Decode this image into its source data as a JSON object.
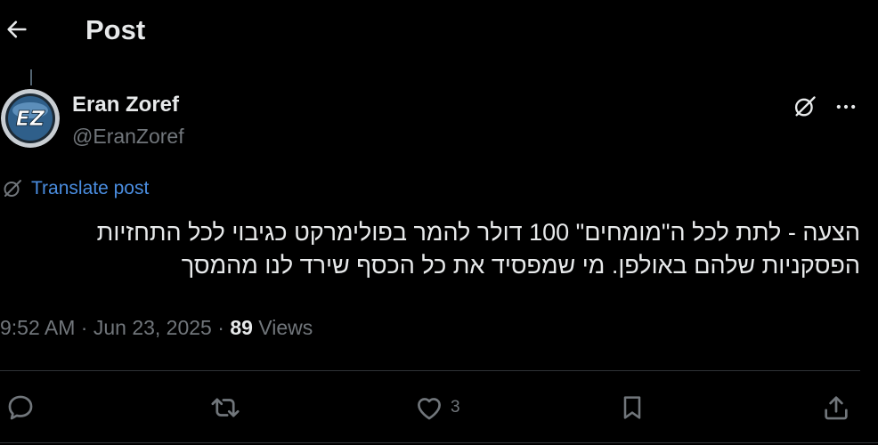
{
  "header": {
    "title": "Post"
  },
  "author": {
    "name": "Eran Zoref",
    "handle": "@EranZoref",
    "avatar_initials": "EZ"
  },
  "translate": {
    "label": "Translate post"
  },
  "post": {
    "line1": "הצעה - לתת לכל ה\"מומחים\" 100 דולר להמר בפולימרקט כגיבוי לכל התחזיות",
    "line2": "הפסקניות שלהם באולפן. מי שמפסיד את כל הכסף שירד לנו מהמסך"
  },
  "meta": {
    "time": "9:52 AM",
    "separator": "·",
    "date": "Jun 23, 2025",
    "views_count": "89",
    "views_label": "Views"
  },
  "actions": {
    "like_count": "3"
  },
  "colors": {
    "background": "#000000",
    "text": "#e7e9ea",
    "muted": "#71767b",
    "link": "#4a8de0",
    "divider": "#2f3336"
  },
  "icons": [
    "back-arrow-icon",
    "grok-icon",
    "more-icon",
    "reply-icon",
    "repost-icon",
    "like-icon",
    "bookmark-icon",
    "share-icon"
  ]
}
